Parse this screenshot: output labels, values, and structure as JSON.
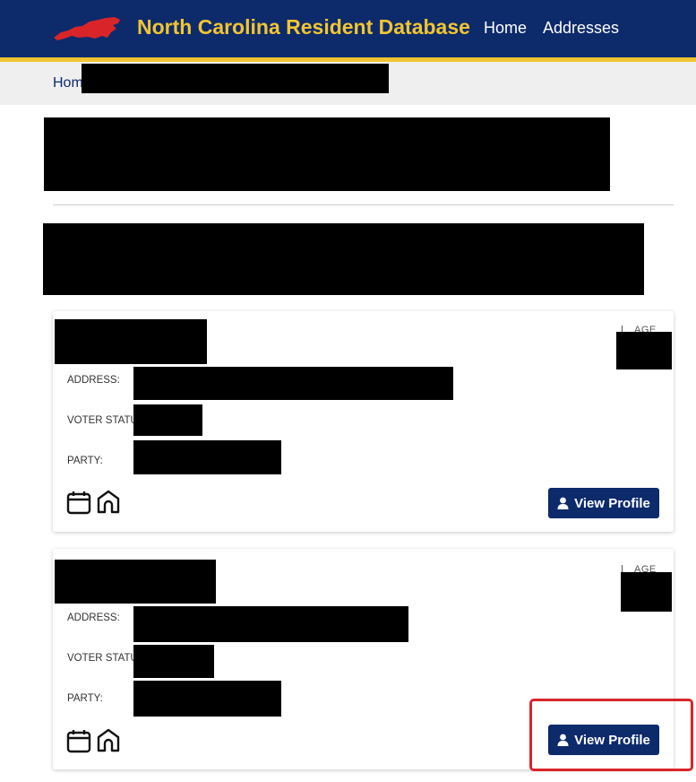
{
  "header": {
    "brand": "North Carolina Resident Database",
    "nav": {
      "home": "Home",
      "addresses": "Addresses"
    },
    "colors": {
      "navy": "#0d2a6b",
      "gold": "#f2c531",
      "state_red": "#d9252a"
    }
  },
  "breadcrumb": {
    "visible_text": "Hom"
  },
  "cards": [
    {
      "age_label": "AGE",
      "address_label": "ADDRESS:",
      "voter_status_label": "VOTER STATUS",
      "party_label": "PARTY:",
      "view_profile_label": "View Profile",
      "icons": [
        "calendar-icon",
        "house-icon"
      ]
    },
    {
      "age_label": "AGE",
      "address_label": "ADDRESS:",
      "voter_status_label": "VOTER STATUS",
      "party_label": "PARTY:",
      "view_profile_label": "View Profile",
      "icons": [
        "calendar-icon",
        "house-icon"
      ]
    }
  ]
}
